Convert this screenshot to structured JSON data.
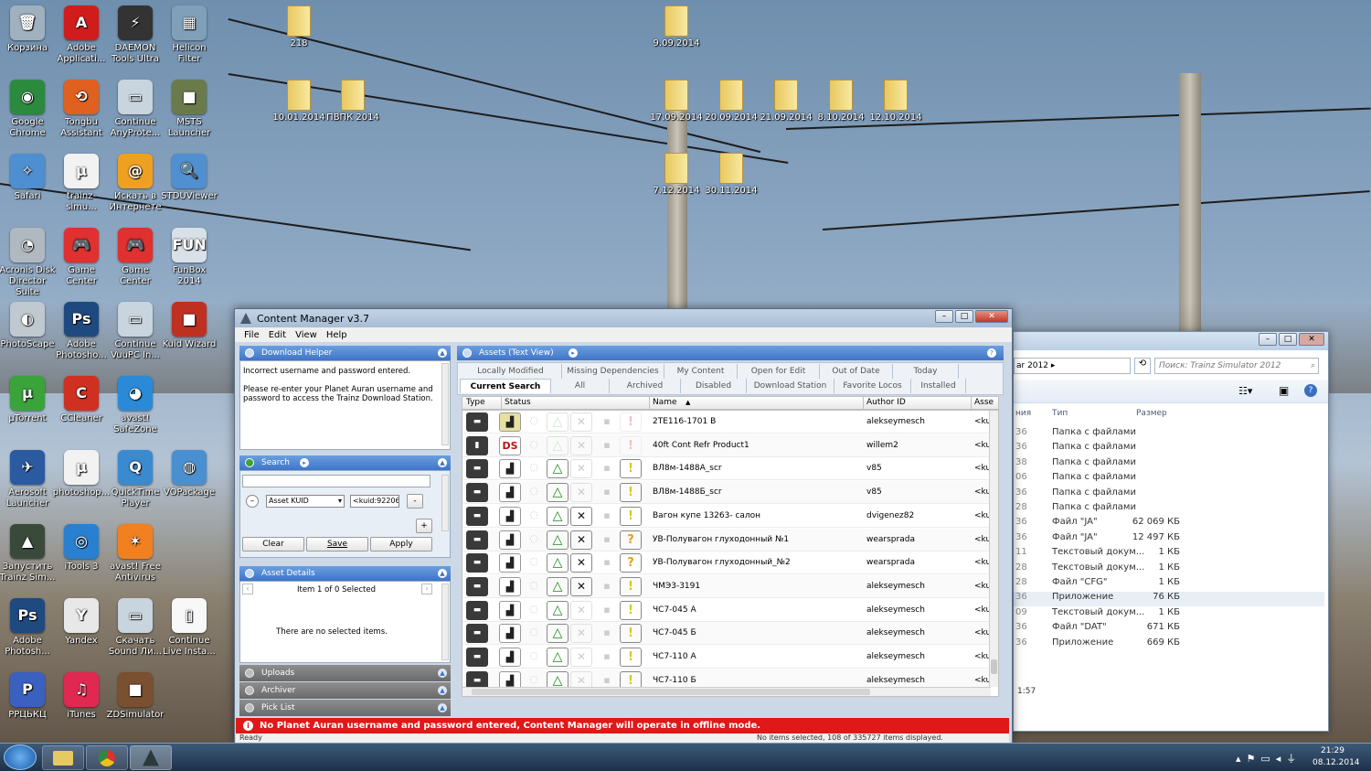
{
  "desktop": {
    "icons": [
      {
        "label": "Корзина",
        "color": "#9fb0bf",
        "glyph": "🗑"
      },
      {
        "label": "Adobe Applicati...",
        "color": "#d11c1c",
        "glyph": "A"
      },
      {
        "label": "DAEMON Tools Ultra",
        "color": "#333333",
        "glyph": "⚡"
      },
      {
        "label": "Helicon Filter",
        "color": "#7fa0b8",
        "glyph": "▦"
      },
      {
        "label": "Google Chrome",
        "color": "#2b8a3e",
        "glyph": "◉"
      },
      {
        "label": "Tongbu Assistant",
        "color": "#e06020",
        "glyph": "⟲"
      },
      {
        "label": "Continue AnyProte...",
        "color": "#c8d4de",
        "glyph": "▭"
      },
      {
        "label": "MSTS Launcher",
        "color": "#6a7a4a",
        "glyph": "■"
      },
      {
        "label": "Safari",
        "color": "#4d8fd0",
        "glyph": "✧"
      },
      {
        "label": "trainz-simu...",
        "color": "#f2f2f2",
        "glyph": "µ"
      },
      {
        "label": "Искать в Интернете",
        "color": "#f0a020",
        "glyph": "@"
      },
      {
        "label": "STDUViewer",
        "color": "#5090d0",
        "glyph": "🔍"
      },
      {
        "label": "Acronis Disk Director Suite",
        "color": "#b0b8c0",
        "glyph": "◔"
      },
      {
        "label": "Game Center",
        "color": "#e03030",
        "glyph": "🎮"
      },
      {
        "label": "Game Center",
        "color": "#e03030",
        "glyph": "🎮"
      },
      {
        "label": "FunBox 2014",
        "color": "#d8e0e8",
        "glyph": "FUN"
      },
      {
        "label": "PhotoScape",
        "color": "#c0c8d0",
        "glyph": "◐"
      },
      {
        "label": "Adobe Photosho...",
        "color": "#1f4a80",
        "glyph": "Ps"
      },
      {
        "label": "Continue VuuPC In...",
        "color": "#c8d4de",
        "glyph": "▭"
      },
      {
        "label": "Kuid Wizard",
        "color": "#c03020",
        "glyph": "■"
      },
      {
        "label": "µTorrent",
        "color": "#3aa33a",
        "glyph": "µ"
      },
      {
        "label": "CCleaner",
        "color": "#d03020",
        "glyph": "C"
      },
      {
        "label": "avast! SafeZone",
        "color": "#2a8ad8",
        "glyph": "◕"
      },
      {
        "label": "",
        "color": "transparent",
        "glyph": ""
      },
      {
        "label": "Aerosoft Launcher",
        "color": "#2a5aa0",
        "glyph": "✈"
      },
      {
        "label": "photoshop...",
        "color": "#f2f2f2",
        "glyph": "µ"
      },
      {
        "label": "QuickTime Player",
        "color": "#3a8ad0",
        "glyph": "Q"
      },
      {
        "label": "VOPackage",
        "color": "#4a90d0",
        "glyph": "◍"
      },
      {
        "label": "Запустить Trainz Sim...",
        "color": "#3a4a3a",
        "glyph": "▲"
      },
      {
        "label": "iTools 3",
        "color": "#2a80d0",
        "glyph": "◎"
      },
      {
        "label": "avast! Free Antivirus",
        "color": "#f08020",
        "glyph": "✶"
      },
      {
        "label": "",
        "color": "transparent",
        "glyph": ""
      },
      {
        "label": "Adobe Photosh...",
        "color": "#1f4a80",
        "glyph": "Ps"
      },
      {
        "label": "Yandex",
        "color": "#e8e8e8",
        "glyph": "Y"
      },
      {
        "label": "Скачать Sound Ли...",
        "color": "#c8d4de",
        "glyph": "▭"
      },
      {
        "label": "Continue Live Insta...",
        "color": "#f8f8f8",
        "glyph": "▯"
      },
      {
        "label": "PPЦЬКЦ",
        "color": "#3a60c0",
        "glyph": "P"
      },
      {
        "label": "iTunes",
        "color": "#e02850",
        "glyph": "♫"
      },
      {
        "label": "ZDSimulator",
        "color": "#7a5030",
        "glyph": "■"
      }
    ],
    "folders": [
      "218",
      "9.09.2014",
      "10.01.2014",
      "ПВПК 2014",
      "17.09.2014",
      "20.09.2014",
      "21.09.2014",
      "8.10.2014",
      "12.10.2014",
      "7.12.2014",
      "30.11.2014"
    ]
  },
  "explorer": {
    "breadcrumb": "ar 2012",
    "search_placeholder": "Поиск: Trainz Simulator 2012",
    "col_type": "Тип",
    "col_size": "Размер",
    "col_partial": "ния",
    "rows": [
      {
        "d": "36",
        "type": "Папка с файлами",
        "size": ""
      },
      {
        "d": "36",
        "type": "Папка с файлами",
        "size": ""
      },
      {
        "d": "38",
        "type": "Папка с файлами",
        "size": ""
      },
      {
        "d": "06",
        "type": "Папка с файлами",
        "size": ""
      },
      {
        "d": "36",
        "type": "Папка с файлами",
        "size": ""
      },
      {
        "d": "28",
        "type": "Папка с файлами",
        "size": ""
      },
      {
        "d": "36",
        "type": "Файл \"JA\"",
        "size": "62 069 КБ"
      },
      {
        "d": "36",
        "type": "Файл \"JA\"",
        "size": "12 497 КБ"
      },
      {
        "d": "11",
        "type": "Текстовый докум...",
        "size": "1 КБ"
      },
      {
        "d": "28",
        "type": "Текстовый докум...",
        "size": "1 КБ"
      },
      {
        "d": "28",
        "type": "Файл \"CFG\"",
        "size": "1 КБ"
      },
      {
        "d": "36",
        "type": "Приложение",
        "size": "76 КБ"
      },
      {
        "d": "09",
        "type": "Текстовый докум...",
        "size": "1 КБ"
      },
      {
        "d": "36",
        "type": "Файл \"DAT\"",
        "size": "671 КБ"
      },
      {
        "d": "36",
        "type": "Приложение",
        "size": "669 КБ"
      }
    ],
    "status": "1:57"
  },
  "cm": {
    "title": "Content Manager v3.7",
    "menu": [
      "File",
      "Edit",
      "View",
      "Help"
    ],
    "download_helper": {
      "title": "Download Helper",
      "msg1": "Incorrect username and password entered.",
      "msg2": "Please re-enter your Planet Auran username and password to access the Trainz Download Station."
    },
    "search": {
      "title": "Search",
      "field": "Asset KUID",
      "value": "<kuid:92206:",
      "op": "-",
      "plus": "+",
      "clear": "Clear",
      "save": "Save",
      "apply": "Apply"
    },
    "asset_details": {
      "title": "Asset Details",
      "item": "Item 1 of 0 Selected",
      "empty": "There are no selected items."
    },
    "sections": [
      "Uploads",
      "Archiver",
      "Pick List"
    ],
    "assets": {
      "title": "Assets (Text View)",
      "help": "?",
      "tabs_row1": [
        "Locally Modified",
        "Missing Dependencies",
        "My Content",
        "Open for Edit",
        "Out of Date",
        "Today"
      ],
      "tabs_row2": [
        "Current Search",
        "All",
        "Archived",
        "Disabled",
        "Download Station",
        "Favorite Locos",
        "Installed"
      ],
      "columns": {
        "type": "Type",
        "status": "Status",
        "name": "Name",
        "author": "Author ID",
        "asset": "Asse"
      },
      "rows": [
        {
          "name": "2TE116-1701 B",
          "author": "alekseymesch",
          "kuid": "<ku"
        },
        {
          "name": "40ft Cont Refr Product1",
          "author": "willem2",
          "kuid": "<ku"
        },
        {
          "name": "ВЛ8м-1488А_scr",
          "author": "v85",
          "kuid": "<ku"
        },
        {
          "name": "ВЛ8м-1488Б_scr",
          "author": "v85",
          "kuid": "<ku"
        },
        {
          "name": "Вагон купе 13263- салон",
          "author": "dvigenez82",
          "kuid": "<ku"
        },
        {
          "name": "УВ-Полувагон глуходонный №1",
          "author": "wearsprada",
          "kuid": "<ku"
        },
        {
          "name": "УВ-Полувагон глуходонный_№2",
          "author": "wearsprada",
          "kuid": "<ku"
        },
        {
          "name": "ЧМЭ3-3191",
          "author": "alekseymesch",
          "kuid": "<ku"
        },
        {
          "name": "ЧС7-045 А",
          "author": "alekseymesch",
          "kuid": "<ku"
        },
        {
          "name": "ЧС7-045 Б",
          "author": "alekseymesch",
          "kuid": "<ku"
        },
        {
          "name": "ЧС7-110 А",
          "author": "alekseymesch",
          "kuid": "<ku"
        },
        {
          "name": "ЧС7-110 Б",
          "author": "alekseymesch",
          "kuid": "<ku"
        }
      ]
    },
    "offline_msg": "No Planet Auran username and password entered, Content Manager will operate in offline mode.",
    "status_left": "Ready",
    "status_right": "No items selected, 108 of 335727 items displayed."
  },
  "taskbar": {
    "time": "21:29",
    "date": "08.12.2014"
  }
}
